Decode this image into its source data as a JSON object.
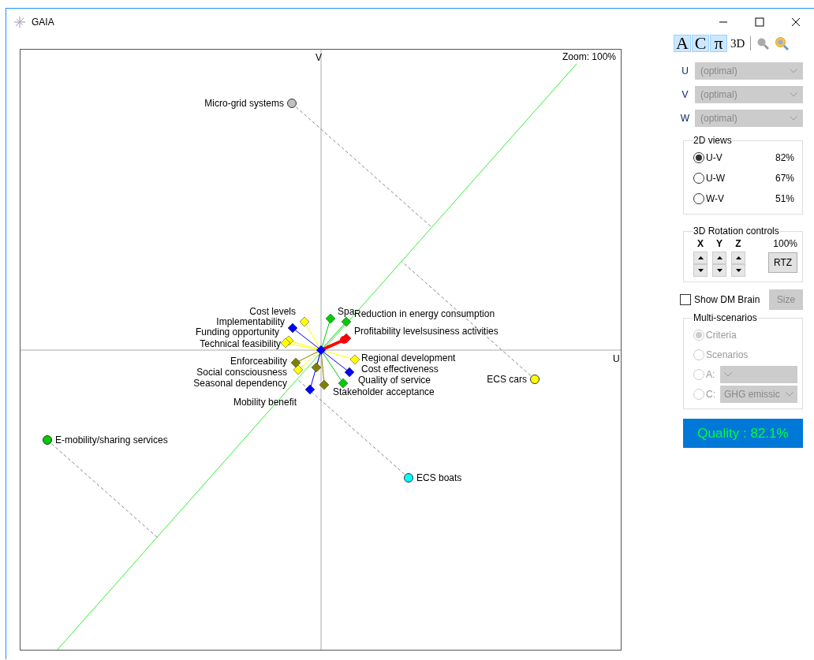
{
  "window": {
    "title": "GAIA"
  },
  "plot": {
    "axis_u": "U",
    "axis_v": "V",
    "zoom": "Zoom: 100%",
    "alternatives": [
      {
        "name": "Micro-grid systems",
        "color": "#c0c0c0"
      },
      {
        "name": "ECS cars",
        "color": "#ffff00"
      },
      {
        "name": "E-mobility/sharing services",
        "color": "#00cc00"
      },
      {
        "name": "ECS boats",
        "color": "#00ffff"
      }
    ],
    "criteria": [
      {
        "name": "Cost levels",
        "color": "#ffff00"
      },
      {
        "name": "Implementability",
        "color": "#0000ff"
      },
      {
        "name": "Funding opportunity",
        "color": "#ffff00"
      },
      {
        "name": "Technical feasibility",
        "color": "#ffff00"
      },
      {
        "name": "Spa",
        "color": "#00cc00"
      },
      {
        "name": "Reduction in energy consumption",
        "color": "#00cc00"
      },
      {
        "name": "Profitability levelsusiness activities",
        "color": "#ff0000"
      },
      {
        "name": "Regional development",
        "color": "#ffff00"
      },
      {
        "name": "Cost effectiveness",
        "color": "#0000ff"
      },
      {
        "name": "Quality of service",
        "color": "#00cc00"
      },
      {
        "name": "Stakeholder acceptance",
        "color": "#808000"
      },
      {
        "name": "Enforceability",
        "color": "#808000"
      },
      {
        "name": "Social consciousness",
        "color": "#ffff00"
      },
      {
        "name": "Seasonal dependency",
        "color": "#808000"
      },
      {
        "name": "Mobility benefit",
        "color": "#0000ff"
      }
    ]
  },
  "toolbar": [
    {
      "label": "A",
      "selected": true
    },
    {
      "label": "C",
      "selected": true
    },
    {
      "label": "π",
      "selected": true
    },
    {
      "label": "3D",
      "selected": false
    }
  ],
  "axes": [
    {
      "label": "U",
      "value": "(optimal)",
      "disabled": true
    },
    {
      "label": "V",
      "value": "(optimal)",
      "disabled": true
    },
    {
      "label": "W",
      "value": "(optimal)",
      "disabled": true
    }
  ],
  "views_2d": {
    "title": "2D views",
    "options": [
      {
        "label": "U-V",
        "percent": "82%",
        "selected": true
      },
      {
        "label": "U-W",
        "percent": "67%",
        "selected": false
      },
      {
        "label": "W-V",
        "percent": "51%",
        "selected": false
      }
    ]
  },
  "rotation": {
    "title": "3D Rotation controls",
    "axes": [
      "X",
      "Y",
      "Z"
    ],
    "zoom": "100%",
    "reset_button": "RTZ"
  },
  "show_dm_brain": {
    "label": "Show DM Brain",
    "checked": false
  },
  "size_button": {
    "label": "Size",
    "disabled": true
  },
  "multi_scenarios": {
    "title": "Multi-scenarios",
    "options": [
      {
        "label": "Criteria",
        "selected": true,
        "disabled": true
      },
      {
        "label": "Scenarios",
        "selected": false,
        "disabled": true
      },
      {
        "label": "A:",
        "selected": false,
        "disabled": true,
        "kind": "dropdown"
      },
      {
        "label": "C:",
        "selected": false,
        "disabled": true,
        "kind": "dropdown",
        "value": "GHG emissic"
      }
    ]
  },
  "quality": "Quality : 82.1%"
}
